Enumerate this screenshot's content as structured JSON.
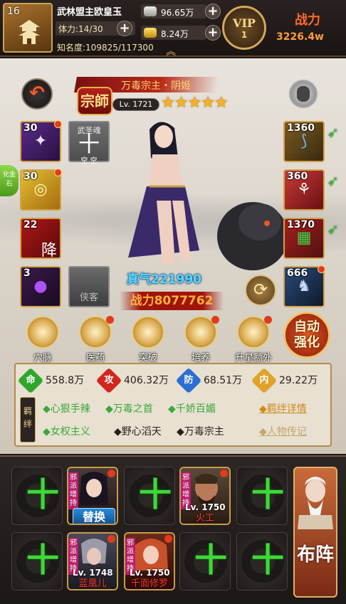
{
  "player": {
    "level": "16",
    "name": "武林盟主欧皇玉",
    "stamina": "体力:14/30",
    "fame": "知名度:109825/117300",
    "silver": "96.65万",
    "gold": "8.24万",
    "vip_label": "VIP",
    "vip_level": "1",
    "power_title": "战力",
    "power_value": "3226.4w"
  },
  "hero": {
    "title": "万毒宗主・阴姬",
    "realm": "宗師",
    "level": "Lv. 1721",
    "stars": "★★★★★",
    "qi": "真气221990",
    "combat_power": "战力8077762",
    "side_tab": "化金石"
  },
  "left_slots": [
    {
      "count": "30"
    },
    {
      "count": "30"
    },
    {
      "count": "22",
      "glyph": "降"
    },
    {
      "count": "3"
    }
  ],
  "soul_slot": {
    "label": "武圣魂",
    "plus": "十",
    "sub": "空  空"
  },
  "guest_slot": {
    "label": "侠客"
  },
  "right_slots": [
    {
      "count": "1360"
    },
    {
      "count": "360"
    },
    {
      "count": "1370"
    },
    {
      "count": "666"
    }
  ],
  "actions": [
    {
      "label": "穴脉"
    },
    {
      "label": "医药"
    },
    {
      "label": "突破"
    },
    {
      "label": "培养"
    },
    {
      "label": "升星额外"
    }
  ],
  "auto_button": {
    "line1": "自动",
    "line2": "强化"
  },
  "stats": [
    {
      "icon": "命",
      "value": "558.8万"
    },
    {
      "icon": "攻",
      "value": "406.32万"
    },
    {
      "icon": "防",
      "value": "68.51万"
    },
    {
      "icon": "内",
      "value": "29.22万"
    }
  ],
  "bonds_label": "羁绊",
  "bonds": [
    {
      "text": "◆心狠手辣",
      "active": true
    },
    {
      "text": "◆万毒之首",
      "active": true
    },
    {
      "text": "◆千娇百媚",
      "active": true
    },
    {
      "text": "◆女权主义",
      "active": true
    },
    {
      "text": "◆野心滔天",
      "active": false
    },
    {
      "text": "◆万毒宗主",
      "active": false
    }
  ],
  "bond_detail_link": "◆羁绊详情",
  "biography_link": "◆人物传记",
  "lineup": [
    {
      "tag": "邪派增持",
      "level": "",
      "name": "",
      "button": "替换"
    },
    {
      "tag": "邪派增持",
      "level": "Lv. 1750",
      "name": "火工"
    },
    {
      "tag": "邪派增持",
      "level": "Lv. 1748",
      "name": "蓝凰儿"
    },
    {
      "tag": "邪派增持",
      "level": "Lv. 1750",
      "name": "千面修罗"
    }
  ],
  "empty_plus": "十",
  "lineup_button": "布阵",
  "colors": {
    "accent_gold": "#d4a246",
    "power_orange": "#ff6a2c",
    "bond_green": "#3aa83a",
    "qi_blue": "#5ad8ff"
  }
}
